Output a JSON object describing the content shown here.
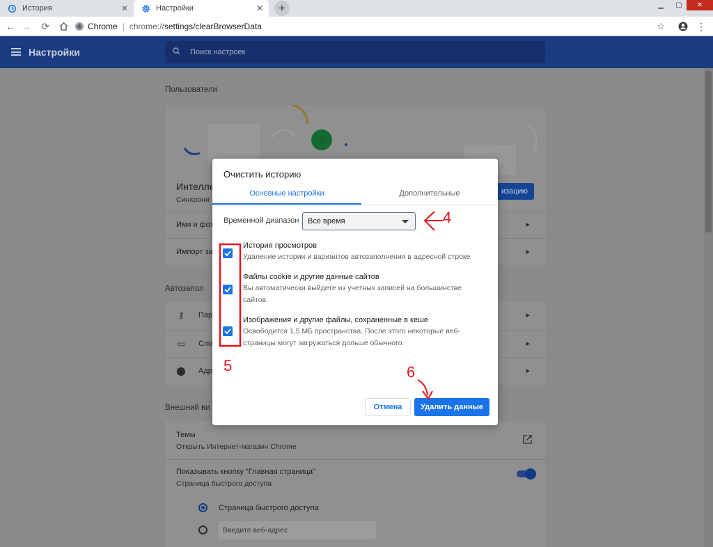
{
  "browser": {
    "tabs": [
      {
        "label": "История",
        "icon": "history-icon",
        "active": false
      },
      {
        "label": "Настройки",
        "icon": "gear-icon",
        "active": true
      }
    ],
    "omnibox": {
      "site": "Chrome",
      "separator": "|",
      "url_prefix": "chrome://",
      "url_path": "settings/clearBrowserData"
    }
  },
  "settings": {
    "title": "Настройки",
    "search_placeholder": "Поиск настроек",
    "people": {
      "label": "Пользователи",
      "profile_name": "Интелле",
      "profile_sub": "Синхрони",
      "sync_button": "изацию",
      "rows": [
        "Имя и фот",
        "Импорт за"
      ]
    },
    "autofill": {
      "label": "Автозапол",
      "rows": [
        {
          "icon": "key-icon",
          "label": "Пар"
        },
        {
          "icon": "credit-card-icon",
          "label": "Спо"
        },
        {
          "icon": "location-pin-icon",
          "label": "Адр"
        }
      ]
    },
    "appearance": {
      "label": "Внешний ви",
      "themes_title": "Темы",
      "themes_sub": "Открыть Интернет-магазин Chrome",
      "home_title": "Показывать кнопку \"Главная страница\"",
      "home_sub": "Страница быстрого доступа",
      "radio_option": "Страница быстрого доступа",
      "url_placeholder": "Введите веб-адрес"
    }
  },
  "dialog": {
    "title": "Очистить историю",
    "tabs": {
      "basic": "Основные настройки",
      "advanced": "Дополнительные"
    },
    "time_range_label": "Временной диапазон",
    "time_range_value": "Все время",
    "items": [
      {
        "title": "История просмотров",
        "desc": "Удаление истории и вариантов автозаполнения в адресной строке",
        "checked": true
      },
      {
        "title": "Файлы cookie и другие данные сайтов",
        "desc": "Вы автоматически выйдете из учетных записей на большинстве сайтов.",
        "checked": true
      },
      {
        "title": "Изображения и другие файлы, сохраненные в кеше",
        "desc": "Освободится 1,5 МБ пространства. После этого некоторые веб-страницы могут загружаться дольше обычного.",
        "checked": true
      }
    ],
    "cancel": "Отмена",
    "delete": "Удалить данные"
  },
  "annotations": {
    "n4": "4",
    "n5": "5",
    "n6": "6",
    "color": "#e8111b"
  },
  "colors": {
    "accent": "#1a73e8",
    "header": "#1a3b80",
    "overlay_bg": "#8a8a8a"
  }
}
